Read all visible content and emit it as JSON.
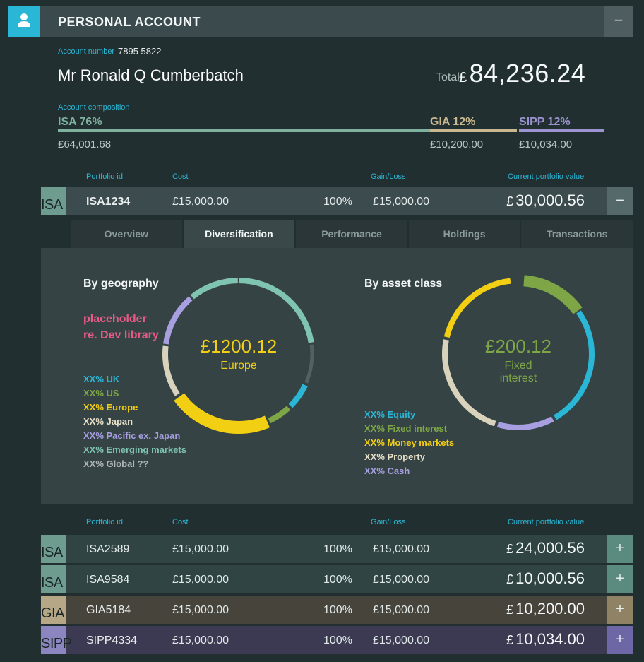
{
  "header": {
    "title": "PERSONAL ACCOUNT",
    "collapse": "−"
  },
  "account": {
    "number_label": "Account number",
    "number": "7895 5822",
    "holder": "Mr Ronald Q Cumberbatch",
    "total_label": "Total:",
    "total_currency": "£",
    "total_value": "84,236.24",
    "composition_label": "Account composition",
    "composition": [
      {
        "name": "ISA 76%",
        "amount": "£64,001.68",
        "color": "#7fb29e",
        "share": 0.76
      },
      {
        "name": "GIA 12%",
        "amount": "£10,200.00",
        "color": "#c9b88f",
        "share": 0.12
      },
      {
        "name": "SIPP 12%",
        "amount": "£10,034.00",
        "color": "#9b94d0",
        "share": 0.12
      }
    ]
  },
  "columns": {
    "portfolio_id": "Portfolio id",
    "cost": "Cost",
    "gain_loss": "Gain/Loss",
    "current_value": "Current portfolio value"
  },
  "expanded": {
    "type": "ISA",
    "id": "ISA1234",
    "cost": "£15,000.00",
    "pct": "100%",
    "gain": "£15,000.00",
    "currency": "£",
    "value": "30,000.56",
    "button": "−",
    "tabs": [
      "Overview",
      "Diversification",
      "Performance",
      "Holdings",
      "Transactions"
    ],
    "active_tab": "Diversification"
  },
  "geography": {
    "title": "By geography",
    "placeholder_line1": "placeholder",
    "placeholder_line2": "re. Dev library",
    "amount": "£1200.12",
    "label": "Europe",
    "legend": [
      {
        "text": "XX% UK",
        "color": "#2ab7d5"
      },
      {
        "text": "XX% US",
        "color": "#7ea646"
      },
      {
        "text": "XX% Europe",
        "color": "#f2cf13"
      },
      {
        "text": "XX% Japan",
        "color": "#e8e0c8"
      },
      {
        "text": "XX% Pacific ex. Japan",
        "color": "#a79fe0"
      },
      {
        "text": "XX% Emerging markets",
        "color": "#7fc4b1"
      },
      {
        "text": "XX% Global ??",
        "color": "#b0b6b6"
      }
    ]
  },
  "asset_class": {
    "title": "By asset class",
    "amount": "£200.12",
    "label_line1": "Fixed",
    "label_line2": "interest",
    "legend": [
      {
        "text": "XX% Equity",
        "color": "#2ab7d5"
      },
      {
        "text": "XX% Fixed interest",
        "color": "#7ea646"
      },
      {
        "text": "XX% Money markets",
        "color": "#f2cf13"
      },
      {
        "text": "XX% Property",
        "color": "#e8e0c8"
      },
      {
        "text": "XX% Cash",
        "color": "#a79fe0"
      }
    ]
  },
  "portfolios": [
    {
      "type": "ISA",
      "id": "ISA2589",
      "cost": "£15,000.00",
      "pct": "100%",
      "gain": "£15,000.00",
      "currency": "£",
      "value": "24,000.56",
      "button": "+",
      "type_color": "#6e9d8f",
      "row_color": "#2f4443",
      "btn_color": "#5a8b7e"
    },
    {
      "type": "ISA",
      "id": "ISA9584",
      "cost": "£15,000.00",
      "pct": "100%",
      "gain": "£15,000.00",
      "currency": "£",
      "value": "10,000.56",
      "button": "+",
      "type_color": "#6e9d8f",
      "row_color": "#2f4443",
      "btn_color": "#5a8b7e"
    },
    {
      "type": "GIA",
      "id": "GIA5184",
      "cost": "£15,000.00",
      "pct": "100%",
      "gain": "£15,000.00",
      "currency": "£",
      "value": "10,200.00",
      "button": "+",
      "type_color": "#b6a887",
      "row_color": "#46443b",
      "btn_color": "#8f8265"
    },
    {
      "type": "SIPP",
      "id": "SIPP4334",
      "cost": "£15,000.00",
      "pct": "100%",
      "gain": "£15,000.00",
      "currency": "£",
      "value": "10,034.00",
      "button": "+",
      "type_color": "#8b86bf",
      "row_color": "#3b3a52",
      "btn_color": "#6d67a6"
    }
  ]
}
